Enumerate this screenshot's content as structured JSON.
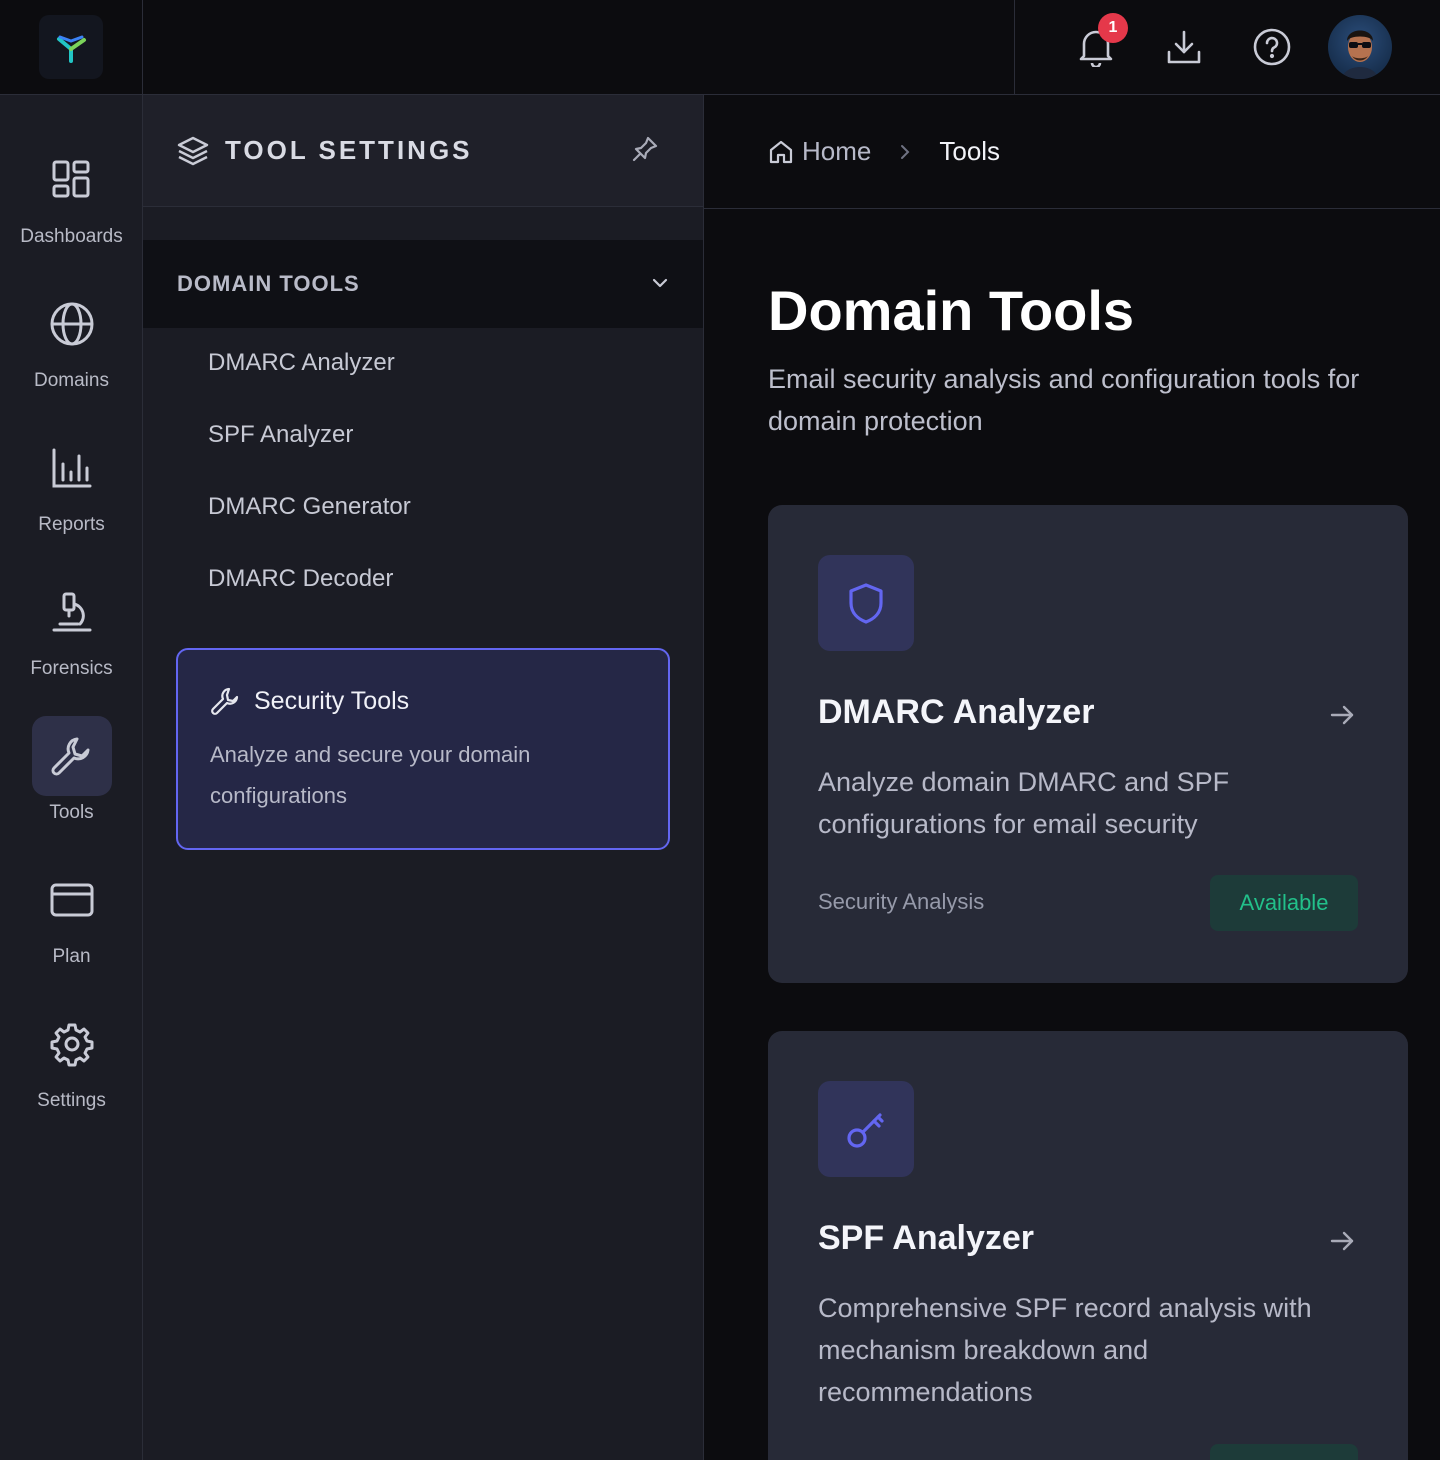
{
  "nav": {
    "items": [
      {
        "label": "Dashboards",
        "icon": "grid-icon"
      },
      {
        "label": "Domains",
        "icon": "globe-icon"
      },
      {
        "label": "Reports",
        "icon": "bar-chart-icon"
      },
      {
        "label": "Forensics",
        "icon": "microscope-icon"
      },
      {
        "label": "Tools",
        "icon": "wrench-icon",
        "active": true
      },
      {
        "label": "Plan",
        "icon": "credit-card-icon"
      },
      {
        "label": "Settings",
        "icon": "gear-icon"
      }
    ]
  },
  "topbar": {
    "notification_count": "1"
  },
  "panel": {
    "title": "TOOL SETTINGS",
    "section": "DOMAIN TOOLS",
    "items": [
      "DMARC Analyzer",
      "SPF Analyzer",
      "DMARC Generator",
      "DMARC Decoder"
    ],
    "card": {
      "title": "Security Tools",
      "description": "Analyze and secure your domain configurations"
    }
  },
  "breadcrumb": {
    "home": "Home",
    "current": "Tools"
  },
  "main": {
    "title": "Domain Tools",
    "subtitle": "Email security analysis and configuration tools for domain protection",
    "tools": [
      {
        "name": "DMARC Analyzer",
        "description": "Analyze domain DMARC and SPF configurations for email security",
        "category": "Security Analysis",
        "status": "Available",
        "icon": "shield-icon"
      },
      {
        "name": "SPF Analyzer",
        "description": "Comprehensive SPF record analysis with mechanism breakdown and recommendations",
        "icon": "key-icon"
      }
    ]
  },
  "colors": {
    "accent": "#6366f1",
    "status_available": "#22c08a",
    "badge": "#e5384a"
  }
}
